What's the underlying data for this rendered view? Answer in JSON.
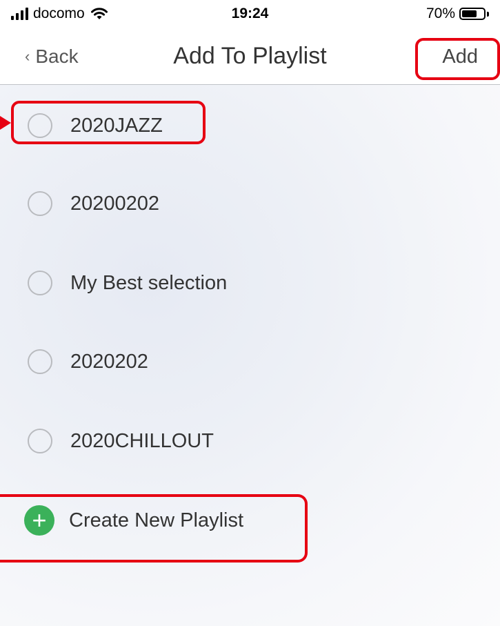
{
  "status_bar": {
    "carrier": "docomo",
    "time": "19:24",
    "battery_percent": "70%",
    "battery_level": 0.7,
    "icons": [
      "signal-bars-icon",
      "wifi-icon",
      "battery-icon"
    ]
  },
  "nav": {
    "back_label": "Back",
    "back_icon": "chevron-left-icon",
    "title": "Add To Playlist",
    "add_label": "Add"
  },
  "playlists": [
    {
      "name": "2020JAZZ",
      "selected": false
    },
    {
      "name": "20200202",
      "selected": false
    },
    {
      "name": "My Best selection",
      "selected": false
    },
    {
      "name": "2020202",
      "selected": false
    },
    {
      "name": "2020CHILLOUT",
      "selected": false
    }
  ],
  "create_new": {
    "label": "Create New Playlist",
    "icon": "plus-circle-icon",
    "icon_color": "#3bb15a"
  },
  "annotation_color": "#e60012"
}
